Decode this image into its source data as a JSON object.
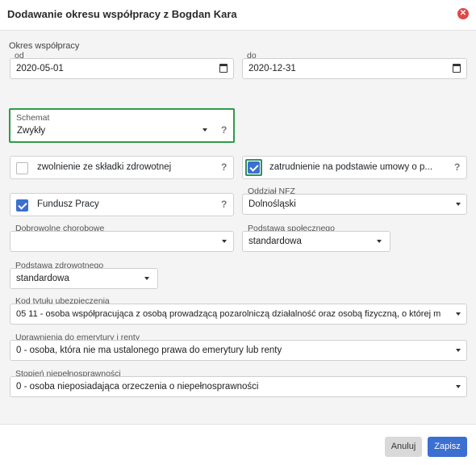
{
  "dialog": {
    "title": "Dodawanie okresu współpracy z Bogdan Kara",
    "close_icon": "close-icon"
  },
  "period": {
    "label": "Okres współpracy",
    "from_label": "od",
    "from_value": "2020-05-01",
    "to_label": "do",
    "to_value": "2020-12-31"
  },
  "schema": {
    "label": "Schemat",
    "value": "Zwykły",
    "help": "?"
  },
  "checks": {
    "health_exempt": {
      "label": "zwolnienie ze składki zdrowotnej",
      "checked": false,
      "help": "?"
    },
    "employment": {
      "label": "zatrudnienie na podstawie umowy o p...",
      "checked": true,
      "help": "?"
    },
    "labor_fund": {
      "label": "Fundusz Pracy",
      "checked": true,
      "help": "?"
    }
  },
  "nfz": {
    "label": "Oddział NFZ",
    "value": "Dolnośląski"
  },
  "voluntary_sickness": {
    "label": "Dobrowolne chorobowe",
    "value": ""
  },
  "social_base": {
    "label": "Podstawa społecznego",
    "value": "standardowa"
  },
  "health_base": {
    "label": "Podstawa zdrowotnego",
    "value": "standardowa"
  },
  "insurance_code": {
    "label": "Kod tytułu ubezpieczenia",
    "value": "05 11 - osoba współpracująca z osobą prowadzącą pozarolniczą działalność oraz osobą fizyczną, o której m"
  },
  "pension_rights": {
    "label": "Uprawnienia do emerytury i renty",
    "value": "0 - osoba, która nie ma ustalonego prawa do emerytury lub renty"
  },
  "disability": {
    "label": "Stopień niepełnosprawności",
    "value": "0 - osoba nieposiadająca orzeczenia o niepełnosprawności"
  },
  "footer": {
    "cancel_label": "Anuluj",
    "save_label": "Zapisz"
  },
  "colors": {
    "accent": "#3b6fd1",
    "highlight_border": "#2f9a4a",
    "close": "#e04848"
  }
}
